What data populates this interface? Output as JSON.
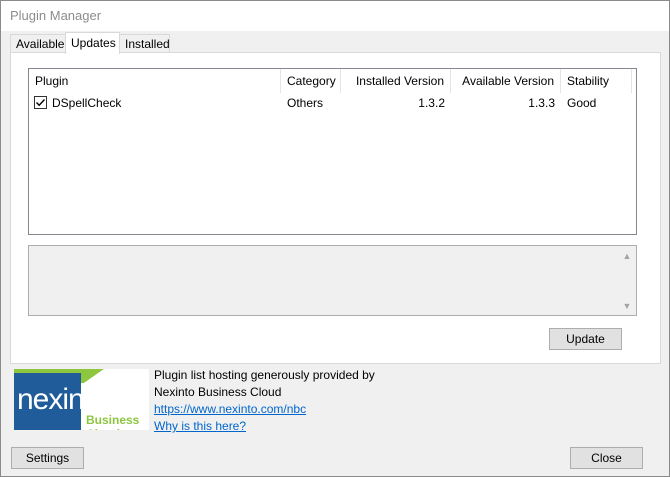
{
  "window": {
    "title": "Plugin Manager"
  },
  "tabs": [
    {
      "label": "Available",
      "active": false
    },
    {
      "label": "Updates",
      "active": true
    },
    {
      "label": "Installed",
      "active": false
    }
  ],
  "plugin_list": {
    "columns": [
      "Plugin",
      "Category",
      "Installed Version",
      "Available Version",
      "Stability"
    ],
    "rows": [
      {
        "checked": true,
        "name": "DSpellCheck",
        "category": "Others",
        "installed_version": "1.3.2",
        "available_version": "1.3.3",
        "stability": "Good"
      }
    ]
  },
  "description": {
    "text": ""
  },
  "buttons": {
    "update": "Update",
    "settings": "Settings",
    "close": "Close"
  },
  "hosting": {
    "line1": "Plugin list hosting generously provided by",
    "line2": "Nexinto Business Cloud",
    "url": "https://www.nexinto.com/nbc",
    "why": "Why is this here?"
  },
  "logo": {
    "name": "nexinto",
    "tagline": "Business Cloud"
  },
  "colors": {
    "logo_blue": "#1f5c99",
    "logo_green": "#8dc63f",
    "link": "#0066cc"
  }
}
